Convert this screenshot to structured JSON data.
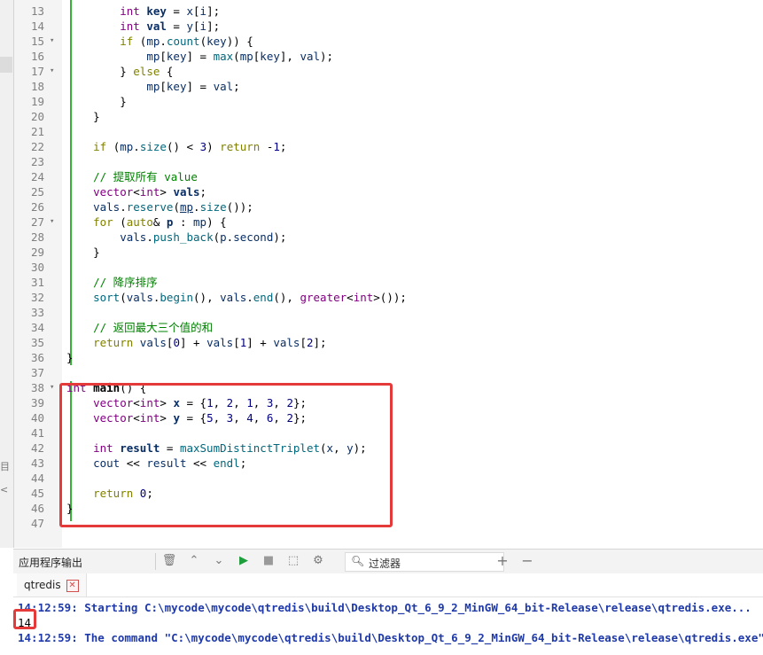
{
  "editor": {
    "lines": [
      {
        "n": "13",
        "fold": "",
        "html": "        <span class='ty'>int</span> <span class='bold var'>key</span> = <span class='var'>x</span>[<span class='var'>i</span>];"
      },
      {
        "n": "14",
        "fold": "",
        "html": "        <span class='ty'>int</span> <span class='bold var'>val</span> = <span class='var'>y</span>[<span class='var'>i</span>];"
      },
      {
        "n": "15",
        "fold": "▾",
        "html": "        <span class='kw'>if</span> (<span class='var'>mp</span>.<span class='fn'>count</span>(<span class='var'>key</span>)) {"
      },
      {
        "n": "16",
        "fold": "",
        "html": "            <span class='var'>mp</span>[<span class='var'>key</span>] = <span class='fn'>max</span>(<span class='var'>mp</span>[<span class='var'>key</span>], <span class='var'>val</span>);"
      },
      {
        "n": "17",
        "fold": "▾",
        "html": "        } <span class='kw'>else</span> {"
      },
      {
        "n": "18",
        "fold": "",
        "html": "            <span class='var'>mp</span>[<span class='var'>key</span>] = <span class='var'>val</span>;"
      },
      {
        "n": "19",
        "fold": "",
        "html": "        }"
      },
      {
        "n": "20",
        "fold": "",
        "html": "    }"
      },
      {
        "n": "21",
        "fold": "",
        "html": ""
      },
      {
        "n": "22",
        "fold": "",
        "html": "    <span class='kw'>if</span> (<span class='var'>mp</span>.<span class='fn'>size</span>() &lt; <span class='num-lit'>3</span>) <span class='kw'>return</span> -<span class='num-lit'>1</span>;"
      },
      {
        "n": "23",
        "fold": "",
        "html": ""
      },
      {
        "n": "24",
        "fold": "",
        "html": "    <span class='cm'>// 提取所有 value</span>"
      },
      {
        "n": "25",
        "fold": "",
        "html": "    <span class='ty'>vector</span>&lt;<span class='ty'>int</span>&gt; <span class='bold var'>vals</span>;"
      },
      {
        "n": "26",
        "fold": "",
        "html": "    <span class='var'>vals</span>.<span class='fn'>reserve</span>(<span class='var' style='text-decoration:underline'>mp</span>.<span class='fn'>size</span>());"
      },
      {
        "n": "27",
        "fold": "▾",
        "html": "    <span class='kw'>for</span> (<span class='kw'>auto</span>&amp; <span class='bold var'>p</span> : <span class='var'>mp</span>) {"
      },
      {
        "n": "28",
        "fold": "",
        "html": "        <span class='var'>vals</span>.<span class='fn'>push_back</span>(<span class='var'>p</span>.<span class='var'>second</span>);"
      },
      {
        "n": "29",
        "fold": "",
        "html": "    }"
      },
      {
        "n": "30",
        "fold": "",
        "html": ""
      },
      {
        "n": "31",
        "fold": "",
        "html": "    <span class='cm'>// 降序排序</span>"
      },
      {
        "n": "32",
        "fold": "",
        "html": "    <span class='fn'>sort</span>(<span class='var'>vals</span>.<span class='fn'>begin</span>(), <span class='var'>vals</span>.<span class='fn'>end</span>(), <span class='ty'>greater</span>&lt;<span class='ty'>int</span>&gt;());"
      },
      {
        "n": "33",
        "fold": "",
        "html": ""
      },
      {
        "n": "34",
        "fold": "",
        "html": "    <span class='cm'>// 返回最大三个值的和</span>"
      },
      {
        "n": "35",
        "fold": "",
        "html": "    <span class='kw'>return</span> <span class='var'>vals</span>[<span class='num-lit'>0</span>] + <span class='var'>vals</span>[<span class='num-lit'>1</span>] + <span class='var'>vals</span>[<span class='num-lit'>2</span>];"
      },
      {
        "n": "36",
        "fold": "",
        "html": "}"
      },
      {
        "n": "37",
        "fold": "",
        "html": ""
      },
      {
        "n": "38",
        "fold": "▾",
        "html": "<span class='ty'>int</span> <span class='bold'>main</span>() {"
      },
      {
        "n": "39",
        "fold": "",
        "html": "    <span class='ty'>vector</span>&lt;<span class='ty'>int</span>&gt; <span class='bold var'>x</span> = {<span class='num-lit'>1</span>, <span class='num-lit'>2</span>, <span class='num-lit'>1</span>, <span class='num-lit'>3</span>, <span class='num-lit'>2</span>};"
      },
      {
        "n": "40",
        "fold": "",
        "html": "    <span class='ty'>vector</span>&lt;<span class='ty'>int</span>&gt; <span class='bold var'>y</span> = {<span class='num-lit'>5</span>, <span class='num-lit'>3</span>, <span class='num-lit'>4</span>, <span class='num-lit'>6</span>, <span class='num-lit'>2</span>};"
      },
      {
        "n": "41",
        "fold": "",
        "html": ""
      },
      {
        "n": "42",
        "fold": "",
        "html": "    <span class='ty'>int</span> <span class='bold var'>result</span> = <span class='fn'>maxSumDistinctTriplet</span>(<span class='var'>x</span>, <span class='var'>y</span>);"
      },
      {
        "n": "43",
        "fold": "",
        "html": "    <span class='var'>cout</span> &lt;&lt; <span class='var'>result</span> &lt;&lt; <span class='fn'>endl</span>;"
      },
      {
        "n": "44",
        "fold": "",
        "html": ""
      },
      {
        "n": "45",
        "fold": "",
        "html": "    <span class='kw'>return</span> <span class='num-lit'>0</span>;"
      },
      {
        "n": "46",
        "fold": "",
        "html": "}"
      },
      {
        "n": "47",
        "fold": "",
        "html": ""
      }
    ]
  },
  "output_pane": {
    "title": "应用程序输出",
    "filter_placeholder": "过滤器",
    "tab_label": "qtredis",
    "lines": [
      "14:12:59: Starting C:\\mycode\\mycode\\qtredis\\build\\Desktop_Qt_6_9_2_MinGW_64_bit-Release\\release\\qtredis.exe...",
      "14",
      "14:12:59: The command \"C:\\mycode\\mycode\\qtredis\\build\\Desktop_Qt_6_9_2_MinGW_64_bit-Release\\release\\qtredis.exe\" finished successfully."
    ]
  },
  "colors": {
    "highlight": "#e53a3a",
    "output_blue": "#1f3aa8",
    "change_bar": "#33b233"
  }
}
